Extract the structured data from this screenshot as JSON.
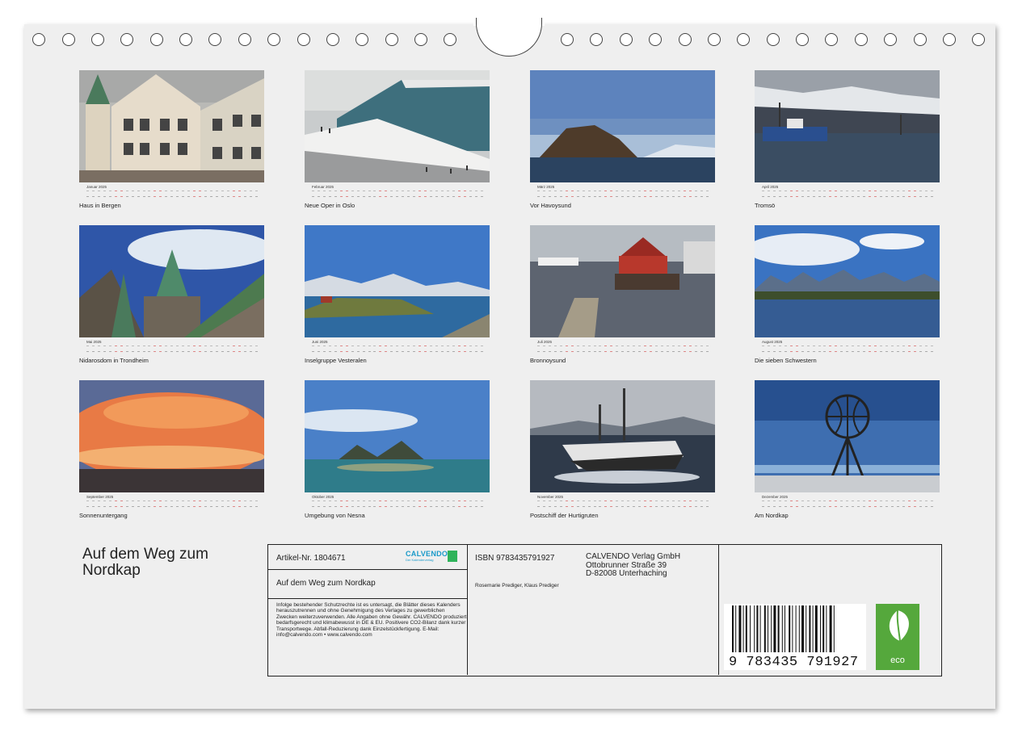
{
  "months": [
    {
      "name": "Januar 2025",
      "caption": "Haus in Bergen"
    },
    {
      "name": "Februar 2025",
      "caption": "Neue Oper in Oslo"
    },
    {
      "name": "März 2025",
      "caption": "Vor Havoysund"
    },
    {
      "name": "April 2025",
      "caption": "Tromsö"
    },
    {
      "name": "Mai 2025",
      "caption": "Nidarosdom in Trondheim"
    },
    {
      "name": "Juni 2025",
      "caption": "Inselgruppe Vesteralen"
    },
    {
      "name": "Juli 2025",
      "caption": "Bronnoysund"
    },
    {
      "name": "August 2025",
      "caption": "Die sieben Schwestern"
    },
    {
      "name": "September 2025",
      "caption": "Sonnenuntergang"
    },
    {
      "name": "Oktober 2025",
      "caption": "Umgebung von Nesna"
    },
    {
      "name": "November 2025",
      "caption": "Postschiff der Hurtigruten"
    },
    {
      "name": "Dezember 2025",
      "caption": "Am Nordkap"
    }
  ],
  "calendar_title": "Auf dem Weg zum Nordkap",
  "info": {
    "artikel": "Artikel-Nr. 1804671",
    "logo_text": "CALVENDO",
    "logo_sub": "Der Kalenderverlag",
    "title": "Auf dem Weg zum Nordkap",
    "legal": "Infolge bestehender Schutzrechte ist es untersagt, die Blätter dieses Kalenders herauszutrennen und ohne Genehmigung des Verlages zu gewerblichen Zwecken weiterzuverwenden. Alle Angaben ohne Gewähr. CALVENDO produziert bedarfsgerecht und klimabewusst in DE & EU. Positivere CO2-Bilanz dank kurzer Transportwege. Abfall-Reduzierung dank Einzelstückfertigung. E-Mail: info@calvendo.com • www.calvendo.com",
    "isbn": "ISBN 9783435791927",
    "publisher_line1": "CALVENDO Verlag GmbH",
    "publisher_line2": "Ottobrunner Straße 39",
    "publisher_line3": "D-82008 Unterhaching",
    "authors": "Rosemarie Prediger, Klaus Prediger",
    "barcode_number": "9 783435 791927",
    "eco_label": "eco"
  },
  "colors": {
    "eco_green": "#55a83c",
    "logo_blue": "#1a9ac9"
  }
}
